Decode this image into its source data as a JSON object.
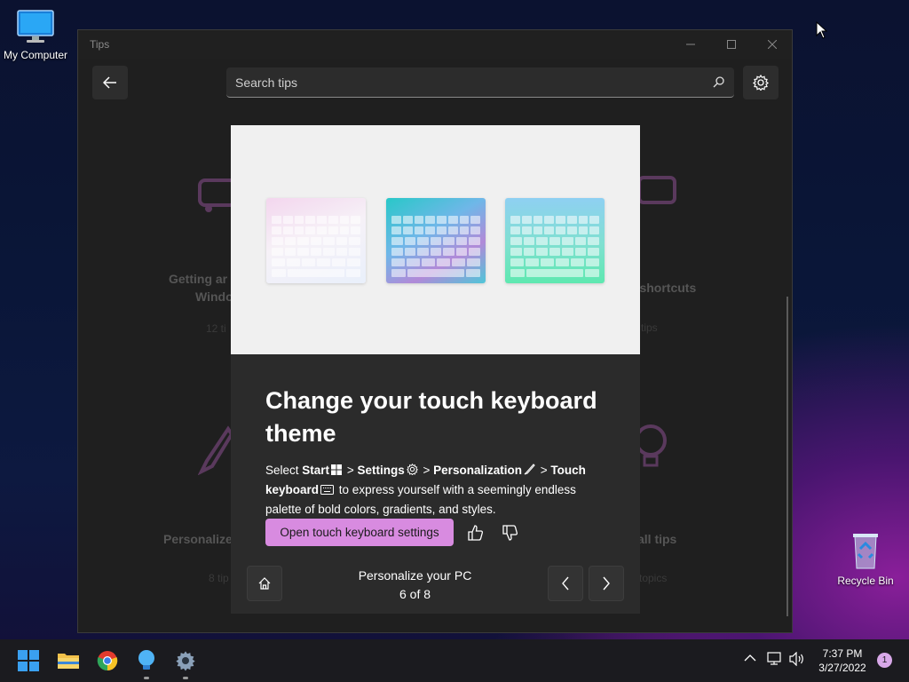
{
  "desktop": {
    "my_computer_label": "My Computer",
    "recycle_bin_label": "Recycle Bin"
  },
  "window": {
    "title": "Tips",
    "search_placeholder": "Search tips"
  },
  "background_tiles": {
    "tile1_title_line1": "Getting ar",
    "tile1_title_line2": "Windo",
    "tile1_sub": "12 ti",
    "tile2_title": "d shortcuts",
    "tile2_sub": "tips",
    "tile3_title": "Personalize",
    "tile3_sub": "8 tip",
    "tile4_title": "all tips",
    "tile4_sub": "topics"
  },
  "dialog": {
    "title": "Change your touch keyboard theme",
    "body": {
      "select": "Select",
      "start": "Start",
      "sep1": ">",
      "settings": "Settings",
      "sep2": ">",
      "personalization": "Personalization",
      "sep3": ">",
      "touch_keyboard": "Touch keyboard",
      "rest": "to express yourself with a seemingly endless palette of bold colors, gradients, and styles."
    },
    "primary_button": "Open touch keyboard settings",
    "collection_name": "Personalize your PC",
    "position": "6 of 8"
  },
  "taskbar": {
    "time": "7:37 PM",
    "date": "3/27/2022",
    "notification_count": "1"
  },
  "colors": {
    "accent": "#d88be0",
    "dialog_bg": "#2b2b2b",
    "window_bg": "#202020"
  }
}
